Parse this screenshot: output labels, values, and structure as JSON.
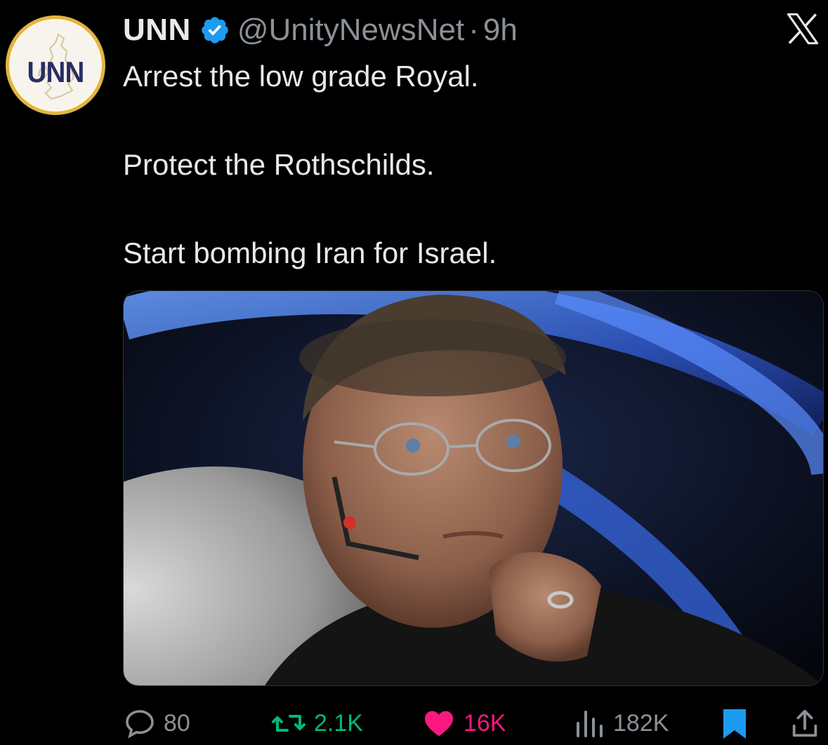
{
  "author": {
    "display_name": "UNN",
    "handle": "@UnityNewsNet",
    "separator": "·",
    "time": "9h",
    "avatar_text": "UNN",
    "verified": true
  },
  "tweet": {
    "lines": [
      "Arrest the low grade Royal.",
      "Protect the Rothschilds.",
      "Start bombing Iran for Israel."
    ]
  },
  "media": {
    "kind": "photo",
    "icon": "movie-still-image"
  },
  "actions": {
    "replies": "80",
    "reposts": "2.1K",
    "likes": "16K",
    "views": "182K"
  },
  "icons": {
    "reply": "reply-icon",
    "repost": "repost-icon",
    "like": "heart-icon",
    "views": "views-chart-icon",
    "bookmark": "bookmark-icon",
    "share": "share-icon",
    "platform": "x-logo-icon"
  },
  "colors": {
    "background": "#000000",
    "text": "#e7e9ea",
    "secondary": "#8b9197",
    "verified": "#1d9bf0",
    "repost_active": "#00ba7c",
    "like_active": "#f91880",
    "bookmark_active": "#1d9bf0"
  }
}
